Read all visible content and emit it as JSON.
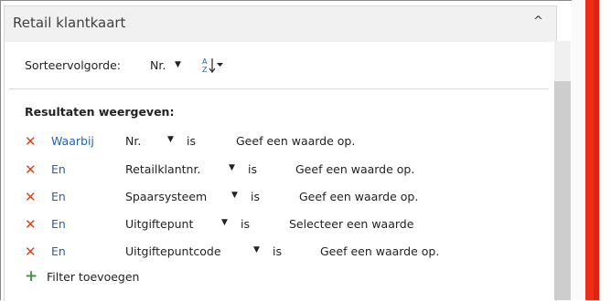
{
  "panel": {
    "title": "Retail klantkaart",
    "collapse_glyph": "^"
  },
  "sort": {
    "label": "Sorteervolgorde:",
    "field": "Nr.",
    "caret": "▼",
    "order_icon": "sort-ascending-az-icon"
  },
  "results_label": "Resultaten weergeven:",
  "filters": [
    {
      "remove_glyph": "✕",
      "conjunction": "Waarbij",
      "field": "Nr.",
      "caret": "▼",
      "operator": "is",
      "value": "Geef een waarde op."
    },
    {
      "remove_glyph": "✕",
      "conjunction": "En",
      "field": "Retailklantnr.",
      "caret": "▼",
      "operator": "is",
      "value": "Geef een waarde op."
    },
    {
      "remove_glyph": "✕",
      "conjunction": "En",
      "field": "Spaarsysteem",
      "caret": "▼",
      "operator": "is",
      "value": "Geef een waarde op."
    },
    {
      "remove_glyph": "✕",
      "conjunction": "En",
      "field": "Uitgiftepunt",
      "caret": "▼",
      "operator": "is",
      "value": "Selecteer een waarde"
    },
    {
      "remove_glyph": "✕",
      "conjunction": "En",
      "field": "Uitgiftepuntcode",
      "caret": "▼",
      "operator": "is",
      "value": "Geef een waarde op."
    }
  ],
  "add_filter": {
    "glyph": "+",
    "label": "Filter toevoegen"
  },
  "colors": {
    "remove_icon": "#d44520",
    "link": "#1f63b8",
    "add_icon": "#3f9a3f",
    "accent_bar": "#ed2d17"
  }
}
